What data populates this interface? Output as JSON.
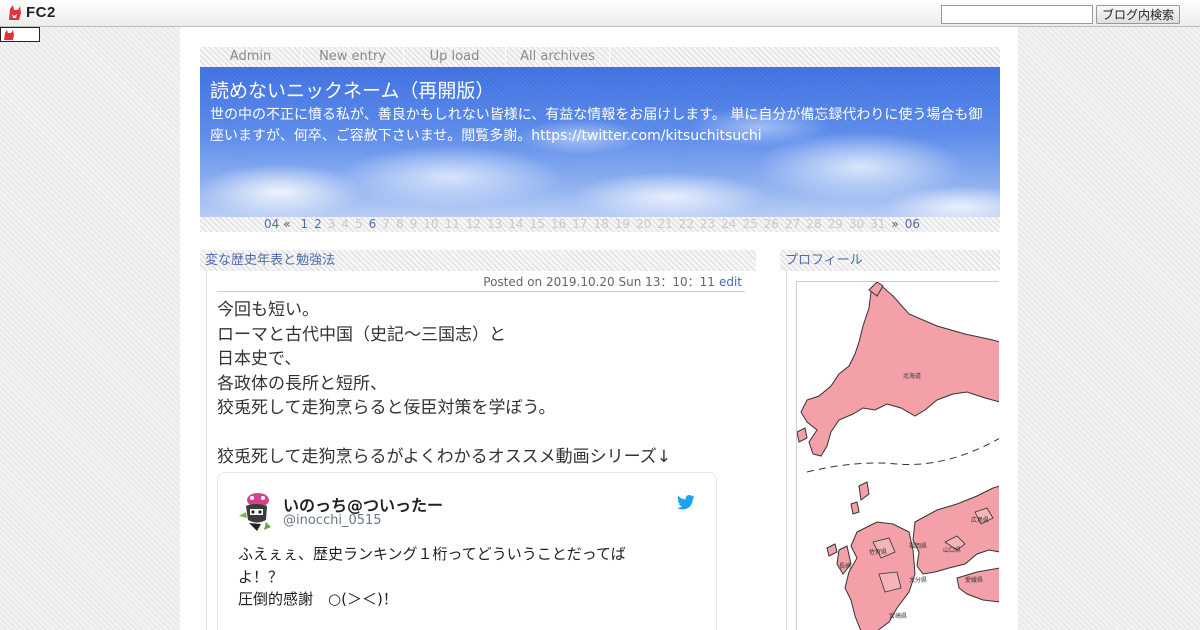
{
  "fc2bar": {
    "logo_text": "FC2",
    "search_placeholder": "",
    "search_button_label": "ブログ内検索"
  },
  "nav": {
    "items": [
      {
        "label": "Admin"
      },
      {
        "label": "New entry"
      },
      {
        "label": "Up load"
      },
      {
        "label": "All archives"
      }
    ]
  },
  "banner": {
    "title": "読めないニックネーム（再開版）",
    "description": "世の中の不正に憤る私が、善良かもしれない皆様に、有益な情報をお届けします。 単に自分が備忘録代わりに使う場合も御座いますが、何卒、ご容赦下さいませ。閲覧多謝。https://twitter.com/kitsuchitsuchi"
  },
  "calendar": {
    "prev_month": "04",
    "prev_arrow": "«",
    "next_arrow": "»",
    "next_month": "06",
    "days": [
      "1",
      "2",
      "3",
      "4",
      "5",
      "6",
      "7",
      "8",
      "9",
      "10",
      "11",
      "12",
      "13",
      "14",
      "15",
      "16",
      "17",
      "18",
      "19",
      "20",
      "21",
      "22",
      "23",
      "24",
      "25",
      "26",
      "27",
      "28",
      "29",
      "30",
      "31"
    ],
    "linked_days": [
      "1",
      "2",
      "6"
    ]
  },
  "entry": {
    "title": "変な歴史年表と勉強法",
    "posted": "Posted on 2019.10.20 Sun 13：10：11",
    "edit_label": "edit",
    "lines": [
      "今回も短い。",
      "ローマと古代中国（史記～三国志）と",
      "日本史で、",
      "各政体の長所と短所、",
      "狡兎死して走狗烹らると佞臣対策を学ぼう。"
    ],
    "after_gap": "狡兎死して走狗烹らるがよくわかるオススメ動画シリーズ↓"
  },
  "tweet": {
    "name": "いのっち@ついったー",
    "handle": "@inocchi_0515",
    "text_lines": [
      "ふえぇぇ、歴史ランキング１桁ってどういうことだってば",
      "よ！？",
      "圧倒的感謝　○(＞＜)！"
    ],
    "icon": "twitter-bird-icon"
  },
  "sidebar": {
    "title": "プロフィール"
  },
  "colors": {
    "link": "#4d6cae",
    "map_fill": "#f4a0a8",
    "twitter_blue": "#1da1f2"
  }
}
